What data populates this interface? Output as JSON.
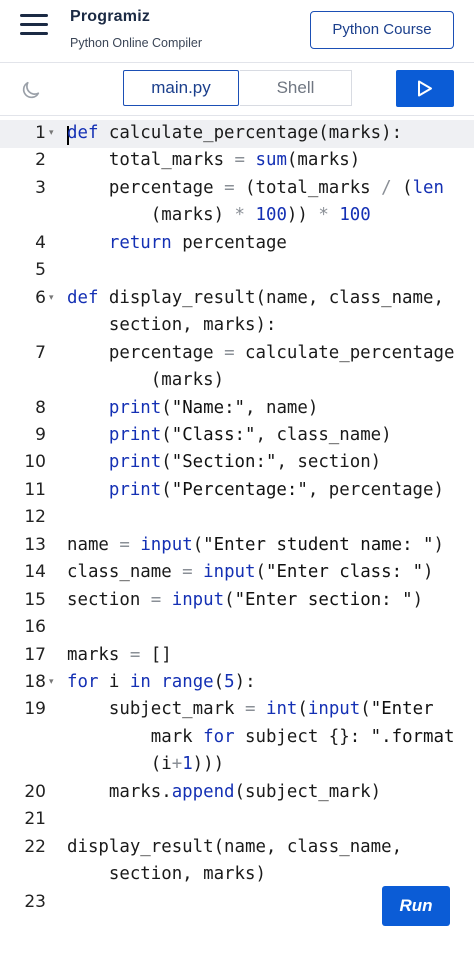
{
  "header": {
    "brand_name": "Programiz",
    "brand_sub": "Python Online Compiler",
    "course_button": "Python Course"
  },
  "toolbar": {
    "tab_main": "main.py",
    "tab_shell": "Shell",
    "run_icon": "play-icon",
    "theme_icon": "moon-icon"
  },
  "editor": {
    "line_numbers": [
      "1",
      "2",
      "3",
      "4",
      "5",
      "6",
      "7",
      "8",
      "9",
      "10",
      "11",
      "12",
      "13",
      "14",
      "15",
      "16",
      "17",
      "18",
      "19",
      "20",
      "21",
      "22",
      "23"
    ],
    "code": [
      "def calculate_percentage(marks):",
      "    total_marks = sum(marks)",
      "    percentage = (total_marks / (len",
      "        (marks) * 100)) * 100",
      "    return percentage",
      "",
      "def display_result(name, class_name,",
      "    section, marks):",
      "    percentage = calculate_percentage",
      "        (marks)",
      "    print(\"Name:\", name)",
      "    print(\"Class:\", class_name)",
      "    print(\"Section:\", section)",
      "    print(\"Percentage:\", percentage)",
      "",
      "name = input(\"Enter student name: \")",
      "class_name = input(\"Enter class: \")",
      "section = input(\"Enter section: \")",
      "",
      "marks = []",
      "for i in range(5):",
      "    subject_mark = int(input(\"Enter",
      "        mark for subject {}: \".format",
      "        (i+1)))",
      "    marks.append(subject_mark)",
      "",
      "display_result(name, class_name,",
      "    section, marks)",
      ""
    ]
  },
  "run_button": "Run"
}
